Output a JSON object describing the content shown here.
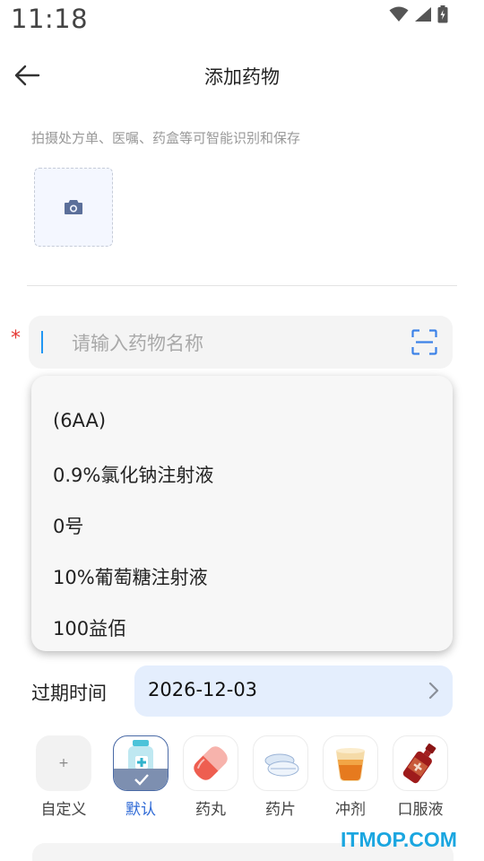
{
  "status_bar": {
    "time": "11:18"
  },
  "app_bar": {
    "title": "添加药物"
  },
  "photo": {
    "hint": "拍摄处方单、医嘱、药盒等可智能识别和保存"
  },
  "name_field": {
    "required_mark": "*",
    "placeholder": "请输入药物名称",
    "value": ""
  },
  "suggestions": [
    "(6AA)",
    "0.9%氯化钠注射液",
    "0号",
    "10%葡萄糖注射液",
    "100益佰"
  ],
  "expiry": {
    "label": "过期时间",
    "value": "2026-12-03"
  },
  "types": [
    {
      "label": "自定义",
      "icon": "plus-icon",
      "symbol": "+"
    },
    {
      "label": "默认",
      "icon": "medicine-bottle-icon",
      "selected": true
    },
    {
      "label": "药丸",
      "icon": "capsule-icon"
    },
    {
      "label": "药片",
      "icon": "tablet-icon"
    },
    {
      "label": "冲剂",
      "icon": "granule-drink-icon"
    },
    {
      "label": "口服液",
      "icon": "oral-liquid-bottle-icon"
    }
  ],
  "watermark": "ITMOP.COM",
  "colors": {
    "accent": "#2f6ad6",
    "required": "#e53935",
    "expiry_bg": "#e4eefd",
    "input_bg": "#f4f4f4"
  }
}
